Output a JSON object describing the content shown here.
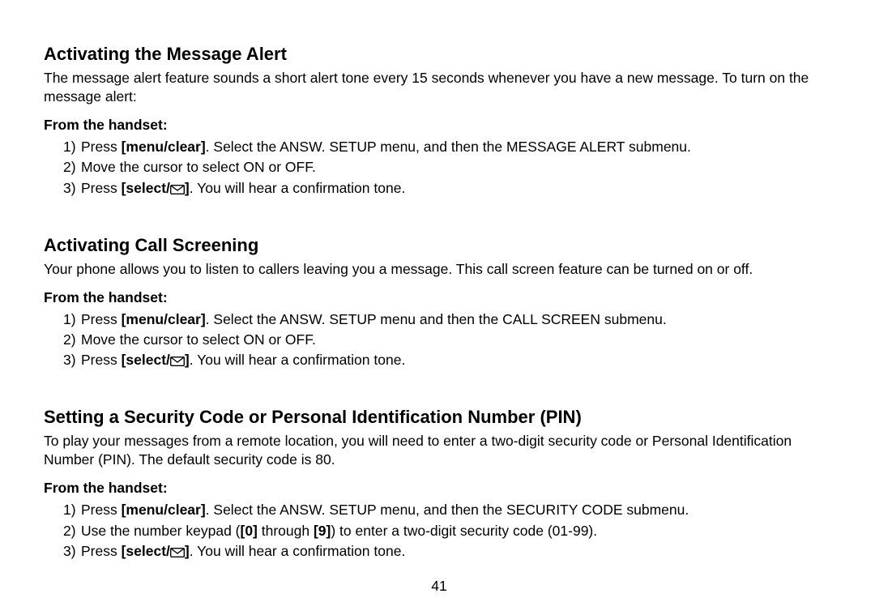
{
  "section1": {
    "heading": "Activating the Message Alert",
    "intro": "The message alert feature sounds a short alert tone every 15 seconds whenever you have a new message. To turn on the message alert:",
    "subhead": "From the handset:",
    "s1_pre": "Press ",
    "s1_key": "[menu/clear]",
    "s1_post": ". Select the ANSW. SETUP menu, and then the MESSAGE ALERT submenu.",
    "s2": "Move the cursor to select ON or OFF.",
    "s3_pre": "Press ",
    "s3_key": "[select/",
    "s3_key2": "]",
    "s3_post": ". You will hear a confirmation tone."
  },
  "section2": {
    "heading": "Activating Call Screening",
    "intro": "Your phone allows you to listen to callers leaving you a message. This call screen feature can be turned on or off.",
    "subhead": "From the handset:",
    "s1_pre": "Press ",
    "s1_key": "[menu/clear]",
    "s1_post": ". Select the ANSW. SETUP menu and then the CALL SCREEN submenu.",
    "s2": "Move the cursor to select ON or OFF.",
    "s3_pre": "Press ",
    "s3_key": "[select/",
    "s3_key2": "]",
    "s3_post": ". You will hear a confirmation tone."
  },
  "section3": {
    "heading": "Setting a Security Code or Personal Identification Number (PIN)",
    "intro": "To play your messages from a remote location, you will need to enter a two-digit security code or Personal Identification Number (PIN). The default security code is 80.",
    "subhead": "From the handset:",
    "s1_pre": "Press ",
    "s1_key": "[menu/clear]",
    "s1_post": ". Select the ANSW. SETUP menu, and then the SECURITY CODE submenu.",
    "s2_pre": "Use the number keypad (",
    "s2_key1": "[0]",
    "s2_mid": " through ",
    "s2_key2": "[9]",
    "s2_post": ") to enter a two-digit security code (01-99).",
    "s3_pre": "Press ",
    "s3_key": "[select/",
    "s3_key2": "]",
    "s3_post": ". You will hear a confirmation tone."
  },
  "labels": {
    "n1": "1)",
    "n2": "2)",
    "n3": "3)"
  },
  "page": "41"
}
